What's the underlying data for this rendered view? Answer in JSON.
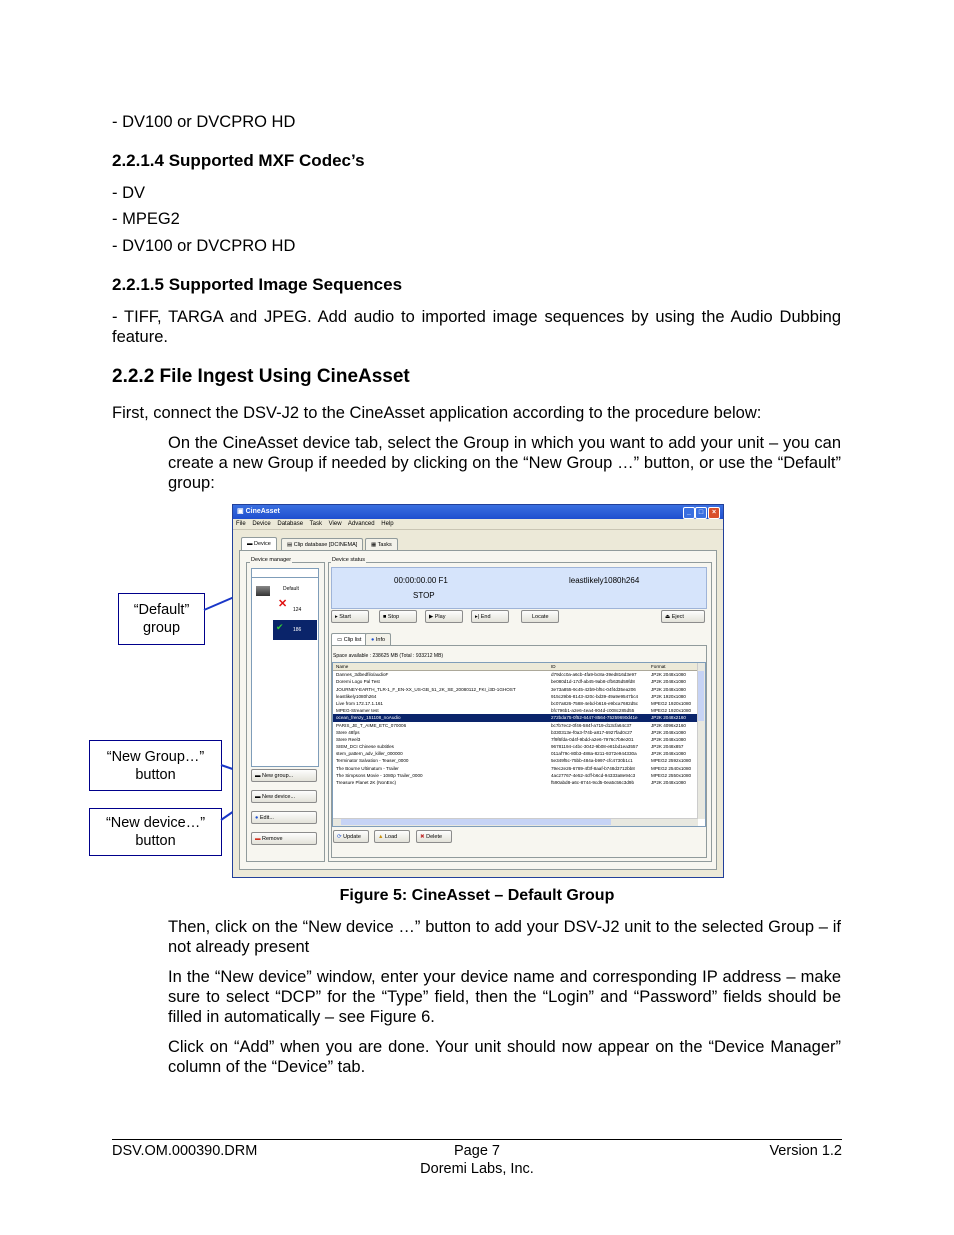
{
  "body": {
    "line_dv100_top": "- DV100 or DVCPRO HD",
    "h_2214": "2.2.1.4  Supported MXF Codec’s",
    "mxf_list": [
      "- DV",
      "- MPEG2",
      "- DV100 or DVCPRO HD"
    ],
    "h_2215": "2.2.1.5  Supported Image Sequences",
    "image_seq_text": "- TIFF, TARGA and JPEG. Add audio to imported image sequences by using the Audio Dubbing feature.",
    "h_222": "2.2.2  File Ingest Using CineAsset",
    "intro": "First, connect the DSV-J2 to the CineAsset application according to the procedure below:",
    "step1": "On the CineAsset device tab, select the Group in which you want to add your unit – you can create a new Group if needed by clicking on the “New Group …” button, or use the “Default” group:",
    "figure_caption": "Figure 5: CineAsset – Default Group",
    "step2": "Then, click on the “New device …” button to add your DSV-J2 unit to the selected Group – if not already present",
    "step3": "In the “New device” window, enter your device name and corresponding IP address – make sure to select “DCP” for the “Type” field, then the “Login” and “Password” fields should be filled in automatically – see Figure 6.",
    "step4": "Click on “Add” when you are done. Your unit should now appear on the “Device Manager” column of the “Device” tab."
  },
  "callouts": {
    "default_group": [
      "“Default”",
      "group"
    ],
    "new_group": [
      "“New Group…”",
      "button"
    ],
    "new_device": [
      "“New device…”",
      "button"
    ]
  },
  "app": {
    "title": "CineAsset",
    "menu": [
      "File",
      "Device",
      "Database",
      "Task",
      "View",
      "Advanced",
      "Help"
    ],
    "tabs": [
      "Device",
      "Clip database [DCINEMA]",
      "Tasks"
    ],
    "device_manager_label": "Device manager",
    "device_status_label": "Device status",
    "tree": [
      "Default",
      "124",
      "186"
    ],
    "timecode": "00:00:00.00 F1",
    "clip_name": "leastlikely1080h264",
    "state": "STOP",
    "transport": [
      "Start",
      "Stop",
      "Play",
      "End",
      "Locate",
      "Eject"
    ],
    "sub_tabs": [
      "Clip list",
      "Info"
    ],
    "space": "Space available : 238625 MB (Total : 933212 MB)",
    "columns": [
      "Name",
      "ID",
      "Format"
    ],
    "rows": [
      [
        "Dannes_3dbedfilo/audioF",
        "d79dcc0a-a6cb-4fa9-bc8a-39ed816d3e97",
        "JP2K 2048x1080"
      ],
      [
        "Doremi Logo Pal Test",
        "be080d1d-17df-ab45-9ab8-cfb635d59fd8",
        "JP2K 2048x1080"
      ],
      [
        "JOURNEY-EARTH_TLR-1_F_EN-XX_US-GB_51_2K_SE_20080112_FKI_i3D-1GHOST",
        "3e73a855-9c45-42b9-bf5c-04f4d35ea206",
        "JP2K 2048x1080"
      ],
      [
        "leastlikely1080h264",
        "915c29b6-8143-420c-bd39-49a9e9547bc4",
        "JP2K 1920x1080"
      ],
      [
        "Live from 172.17.1.161",
        "bc07a826-7588-4ebd-b616-e9bca7682d5c",
        "MPEG2 1920x1080"
      ],
      [
        "MPEG-Streamer test",
        "bfc796b1-a2e6-4ea4-904d-c008c285d55",
        "MPEG2 1920x1080"
      ],
      [
        "ocean_frenzy_151108_noAudio",
        "272bda75-0f52-6447-8564-75259690d41e",
        "JP2K 2048x2160"
      ],
      [
        "PARIS_JE_T_AIME_ETC_070006",
        "bc7b7ec2-0f46-584f-a719-d13cfa64c37",
        "JP2K 4096x2160"
      ],
      [
        "Stere 48fps",
        "b330313e-f0a3-f74b-a817-6927fad0c27",
        "JP2K 2048x1080"
      ],
      [
        "Stere Reel3",
        "7f9f6fda-0d4f-9bdd-a2e6-7976c7b9e201",
        "JP2K 2048x1080"
      ],
      [
        "SIEM_DCI Chinese subtitles",
        "96781194-c4bc-3042-9b08-e81bd1ea3557",
        "JP2K 2048x857"
      ],
      [
        "stem_pattern_adv_killer_000000",
        "011af79c-80b3-488a-8211-9372e944330a",
        "JP2K 2048x1080"
      ],
      [
        "Terminator Salvation - Teaser_0000",
        "5e349f5c-75bb-484a-b997-cfc4730b1c1",
        "MPEG2 2592x1080"
      ],
      [
        "The Bourne Ultimatum - Trailer",
        "79ec2e26-6789-4f3f-8aaf-b748d3712bb8",
        "MPEG2 2540x1080"
      ],
      [
        "The Simpsons Movie - 1080p Trailer_0000",
        "4ac27767-4e52-4cff-b6cd-94333a8e94c3",
        "MPEG2 2550x1080"
      ],
      [
        "Treasure Planet 2K (NonEnc)",
        "f590abd8-a6c-8744-9cd5-0ea5c56c3d9b",
        "JP2K 2048x1080"
      ]
    ],
    "selected_row": 6,
    "bottom_buttons": [
      "Update",
      "Load",
      "Delete"
    ],
    "left_buttons": [
      "New group...",
      "New device...",
      "Edit...",
      "Remove"
    ]
  },
  "footer": {
    "doc_id": "DSV.OM.000390.DRM",
    "page": "Page 7",
    "version": "Version 1.2",
    "company": "Doremi Labs, Inc."
  },
  "colors": {
    "titlebar": "#1f4fcf",
    "callout_border": "#00008b",
    "arrow": "#1a37c8",
    "status_panel": "#d6e4fb"
  }
}
